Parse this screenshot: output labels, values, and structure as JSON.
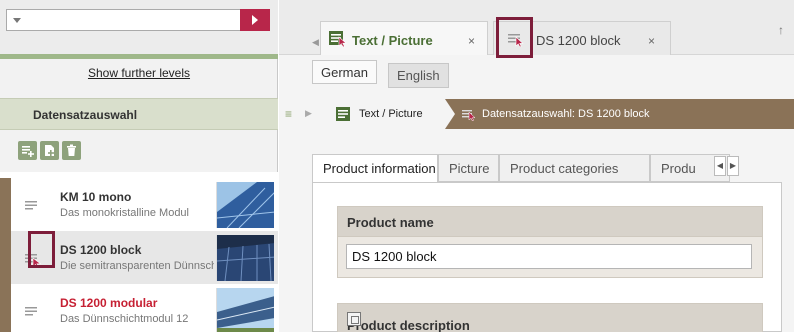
{
  "left_panel": {
    "show_further_levels": "Show further levels",
    "section_title": "Datensatzauswahl",
    "records": [
      {
        "title": "KM 10 mono",
        "description": "Das monokristalline Modul",
        "title_color": "#333333"
      },
      {
        "title": "DS 1200 block",
        "description": "Die semitransparenten Dünnschichtmodule",
        "title_color": "#333333"
      },
      {
        "title": "DS 1200 modular",
        "description": "Das Dünnschichtmodul 12",
        "title_color": "#c62033"
      }
    ]
  },
  "tabs": [
    {
      "label": "Text / Picture",
      "close": "×"
    },
    {
      "label": "DS 1200 block",
      "close": "×"
    }
  ],
  "languages": [
    "German",
    "English"
  ],
  "breadcrumb": {
    "item1": "Text / Picture",
    "item2": "Datensatzauswahl: DS 1200 block"
  },
  "product_tabs": [
    "Product information",
    "Picture",
    "Product categories",
    "Produ"
  ],
  "form": {
    "product_name_label": "Product name",
    "product_name_value": "DS 1200 block",
    "product_description_label": "Product description"
  },
  "colors": {
    "accent": "#b8264a",
    "highlight_box": "#7d1d3a",
    "breadcrumb_bg": "#8a7257",
    "tab_green": "#4b6f35",
    "modified_title": "#c62033"
  }
}
